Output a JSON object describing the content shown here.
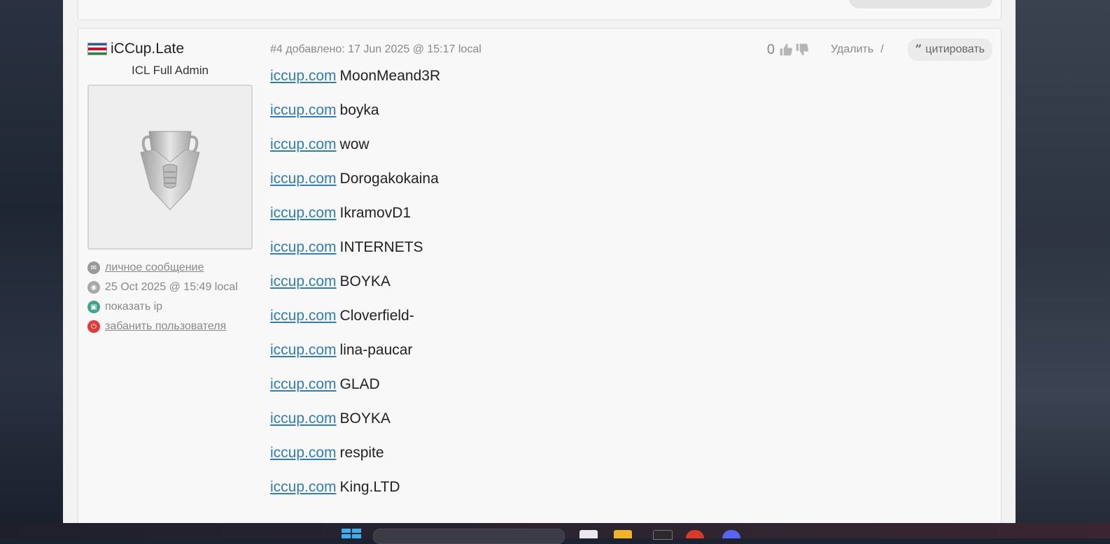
{
  "post": {
    "user": {
      "name": "iCCup.Late",
      "rank": "ICL Full Admin",
      "links": {
        "private_message": "личное сообщение",
        "last_seen": "25 Oct 2025 @ 15:49 local",
        "show_ip": "показать ip",
        "ban_user": "забанить пользователя"
      }
    },
    "meta": {
      "number_and_date": "#4 добавлено: 17 Jun 2025 @ 15:17 local",
      "vote_count": "0",
      "delete_label": "Удалить",
      "separator": "/",
      "quote_label": "цитировать"
    },
    "lines": [
      {
        "link": "iccup.com",
        "text": "MoonMeand3R"
      },
      {
        "link": "iccup.com",
        "text": "boyka"
      },
      {
        "link": "iccup.com",
        "text": "wow"
      },
      {
        "link": "iccup.com",
        "text": "Dorogakokaina"
      },
      {
        "link": "iccup.com",
        "text": "IkramovD1"
      },
      {
        "link": "iccup.com",
        "text": "INTERNETS"
      },
      {
        "link": "iccup.com",
        "text": "BOYKA"
      },
      {
        "link": "iccup.com",
        "text": "Cloverfield-"
      },
      {
        "link": "iccup.com",
        "text": "lina-paucar"
      },
      {
        "link": "iccup.com",
        "text": "GLAD"
      },
      {
        "link": "iccup.com",
        "text": "BOYKA"
      },
      {
        "link": "iccup.com",
        "text": "respite"
      },
      {
        "link": "iccup.com",
        "text": "King.LTD"
      }
    ]
  },
  "icons": {
    "flag": "flag-icon",
    "avatar": "trophy-icon",
    "mail": "mail-icon",
    "clock": "clock-icon",
    "ip": "monitor-icon",
    "ban": "power-icon",
    "like": "thumbs-up-icon",
    "dislike": "thumbs-down-icon",
    "quote": "quote-icon"
  },
  "colors": {
    "link": "#2f7dbd",
    "ban_icon": "#e03a3a",
    "ip_icon": "#3fa58a",
    "muted_text": "#888888"
  }
}
